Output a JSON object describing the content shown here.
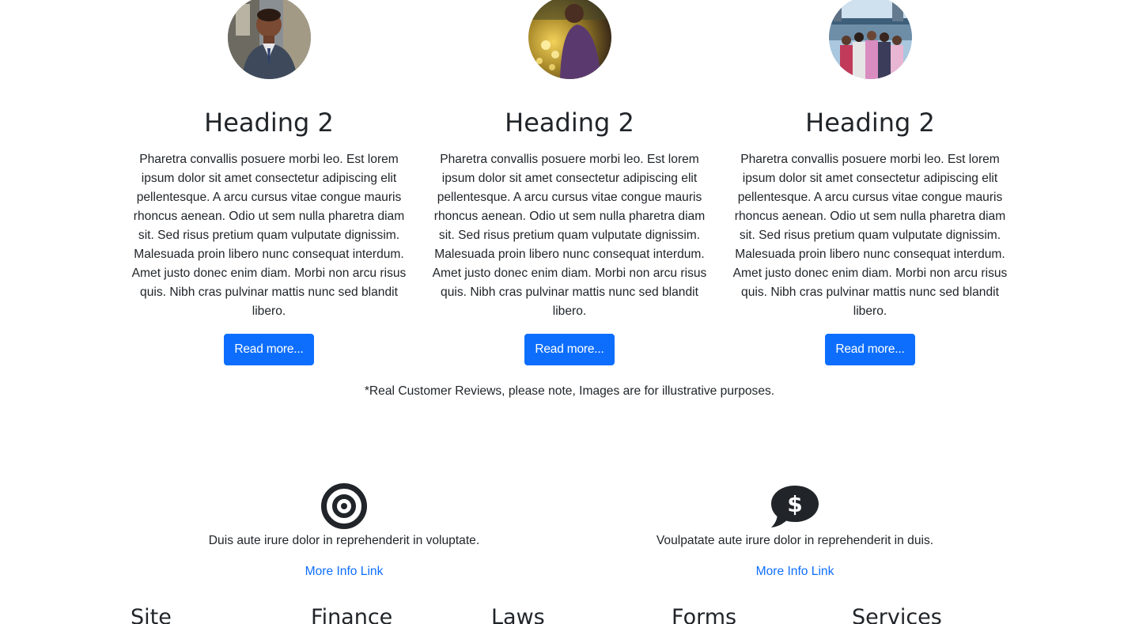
{
  "reviews": [
    {
      "avatar_icon": "person-in-suit-photo",
      "heading": "Heading 2",
      "body": "Pharetra convallis posuere morbi leo. Est lorem ipsum dolor sit amet consectetur adipiscing elit pellentesque. A arcu cursus vitae congue mauris rhoncus aenean. Odio ut sem nulla pharetra diam sit. Sed risus pretium quam vulputate dignissim. Malesuada proin libero nunc consequat interdum. Amet justo donec enim diam. Morbi non arcu risus quis. Nibh cras pulvinar mattis nunc sed blandit libero.",
      "button": "Read more..."
    },
    {
      "avatar_icon": "person-with-lights-photo",
      "heading": "Heading 2",
      "body": "Pharetra convallis posuere morbi leo. Est lorem ipsum dolor sit amet consectetur adipiscing elit pellentesque. A arcu cursus vitae congue mauris rhoncus aenean. Odio ut sem nulla pharetra diam sit. Sed risus pretium quam vulputate dignissim. Malesuada proin libero nunc consequat interdum. Amet justo donec enim diam. Morbi non arcu risus quis. Nibh cras pulvinar mattis nunc sed blandit libero.",
      "button": "Read more..."
    },
    {
      "avatar_icon": "group-by-river-photo",
      "heading": "Heading 2",
      "body": "Pharetra convallis posuere morbi leo. Est lorem ipsum dolor sit amet consectetur adipiscing elit pellentesque. A arcu cursus vitae congue mauris rhoncus aenean. Odio ut sem nulla pharetra diam sit. Sed risus pretium quam vulputate dignissim. Malesuada proin libero nunc consequat interdum. Amet justo donec enim diam. Morbi non arcu risus quis. Nibh cras pulvinar mattis nunc sed blandit libero.",
      "button": "Read more..."
    }
  ],
  "disclaimer": "*Real Customer Reviews, please note, Images are for illustrative purposes.",
  "features": [
    {
      "icon": "bullseye-icon",
      "text": "Duis aute irure dolor in reprehenderit in voluptate.",
      "link": "More Info Link"
    },
    {
      "icon": "chat-dollar-icon",
      "text": "Voulpatate aute irure dolor in reprehenderit in duis.",
      "link": "More Info Link"
    }
  ],
  "footer": {
    "columns": [
      "Site",
      "Finance",
      "Laws",
      "Forms",
      "Services"
    ]
  },
  "colors": {
    "primary": "#0d6efd",
    "text": "#212529",
    "background": "#ffffff"
  }
}
